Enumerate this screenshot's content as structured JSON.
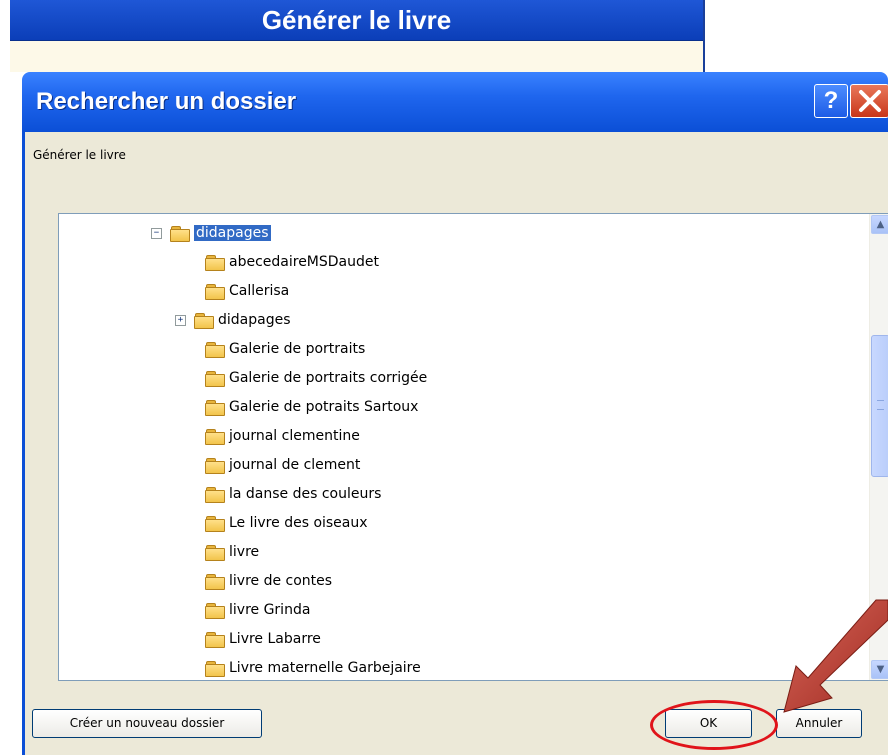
{
  "background_window": {
    "title": "Générer le livre"
  },
  "dialog": {
    "title": "Rechercher un dossier",
    "help_glyph": "?",
    "description": "Générer le livre",
    "tree": [
      {
        "label": "didapages",
        "expander": "⊟",
        "selected": true
      },
      {
        "label": "abecedaireMSDaudet"
      },
      {
        "label": "Callerisa"
      },
      {
        "label": "didapages",
        "expander": "⊞"
      },
      {
        "label": "Galerie de portraits"
      },
      {
        "label": "Galerie de portraits corrigée"
      },
      {
        "label": "Galerie de potraits Sartoux"
      },
      {
        "label": "journal clementine"
      },
      {
        "label": "journal de clement"
      },
      {
        "label": "la danse des couleurs"
      },
      {
        "label": "Le livre des oiseaux"
      },
      {
        "label": "livre"
      },
      {
        "label": "livre de contes"
      },
      {
        "label": "livre Grinda"
      },
      {
        "label": "Livre Labarre"
      },
      {
        "label": "Livre maternelle Garbejaire"
      }
    ],
    "buttons": {
      "new_folder": "Créer un nouveau dossier",
      "ok": "OK",
      "cancel": "Annuler"
    }
  },
  "colors": {
    "titlebar": "#0b4fd6",
    "selection": "#316ac5",
    "annotation_red": "#e0141a",
    "arrow": "#c0392b"
  },
  "icons": [
    "folder-icon",
    "help-icon",
    "close-icon",
    "scroll-up-icon",
    "scroll-down-icon",
    "arrow-annotation"
  ]
}
